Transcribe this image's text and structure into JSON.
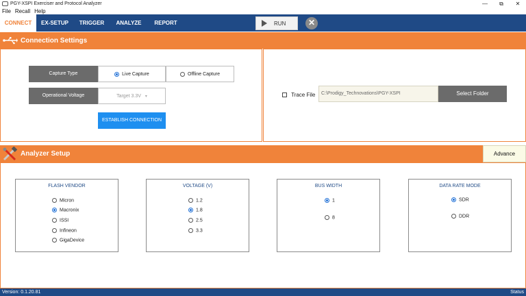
{
  "window": {
    "title": "PGY-XSPI Exerciser and Protocol Analyzer",
    "controls": [
      "—",
      "⧉",
      "✕"
    ]
  },
  "menu": [
    "File",
    "Recall",
    "Help"
  ],
  "tabs": [
    {
      "label": "CONNECT",
      "active": true
    },
    {
      "label": "EX-SETUP",
      "active": false
    },
    {
      "label": "TRIGGER",
      "active": false
    },
    {
      "label": "ANALYZE",
      "active": false
    },
    {
      "label": "REPORT",
      "active": false
    }
  ],
  "toolbar": {
    "run_label": "RUN",
    "stop_glyph": "✕"
  },
  "connection": {
    "heading": "Connection Settings",
    "capture_type_label": "Capture Type",
    "live_capture": "Live Capture",
    "offline_capture": "Offline Capture",
    "voltage_label": "Operational Voltage",
    "voltage_value": "Target 3.3V",
    "establish_button": "ESTABLISH CONNECTION",
    "trace_file_label": "Trace File",
    "trace_path": "C:\\Prodigy_Technovations\\PGY-XSPI",
    "select_folder_button": "Select Folder"
  },
  "analyzer": {
    "heading": "Analyzer Setup",
    "advance_settings": "Advance Settings",
    "groups": [
      {
        "title": "FLASH VENDOR",
        "options": [
          "Micron",
          "Macronix",
          "ISSI",
          "Infineon",
          "GigaDevice"
        ],
        "selected": 1
      },
      {
        "title": "VOLTAGE (V)",
        "options": [
          "1.2",
          "1.8",
          "2.5",
          "3.3"
        ],
        "selected": 1
      },
      {
        "title": "BUS WIDTH",
        "options": [
          "1",
          "8"
        ],
        "selected": 0
      },
      {
        "title": "DATA RATE MODE",
        "options": [
          "SDR",
          "DDR"
        ],
        "selected": 0
      }
    ]
  },
  "status": {
    "version": "Version: 0.1.20.81",
    "status_label": "Status"
  },
  "colors": {
    "accent_orange": "#f0833a",
    "nav_blue": "#1f4a86",
    "button_blue": "#1e8ff0"
  }
}
